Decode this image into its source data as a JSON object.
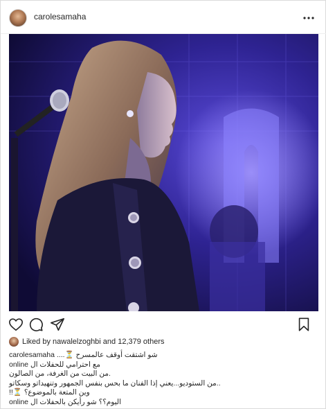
{
  "header": {
    "username": "carolesamaha",
    "avatar_icon": "profile-avatar",
    "more_icon": "more-options-icon"
  },
  "photo": {
    "alt_icon": "concert-photo"
  },
  "actions": {
    "like_icon": "heart-icon",
    "comment_icon": "comment-icon",
    "share_icon": "paper-plane-icon",
    "save_icon": "bookmark-icon"
  },
  "likes": {
    "prefix": "Liked by ",
    "user": "nawalelzoghbi",
    "middle": " and ",
    "count": "12,379",
    "suffix": " others"
  },
  "caption": {
    "owner": "carolesamaha",
    "line1": "شو اشتقت أوقف عالمسرح ⏳....",
    "line2": "مع احترامي للحفلات ال online",
    "line3": ".من البيت من الغرفة، من الصالون",
    "line4": "..من الستوديو...يعني إذا الفنان ما بحس بنفس الجمهور وتنهيداتو وسكاتو",
    "line5": "وين المتعة بالموضوع؟ ⏳!!",
    "line6": "اليوم؟؟ شو رأيكن بالحفلات ال online"
  },
  "colors": {
    "text": "#262626",
    "border": "#dbdbdb",
    "photo_bg": "#1b1340",
    "stage_light": "#6d5cff"
  }
}
